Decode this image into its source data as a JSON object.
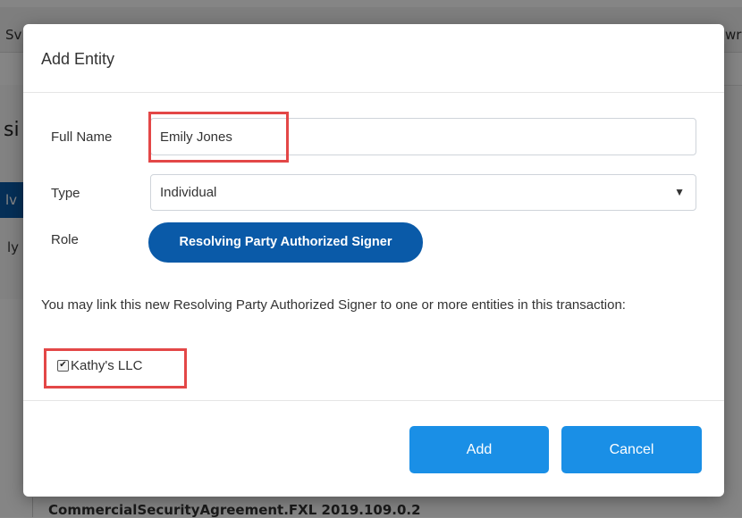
{
  "background": {
    "top_left_text": "Sv",
    "top_right_text": "wr",
    "heading_fragment": "si",
    "tab_fragment": "lv",
    "row_fragment": "ly",
    "bottom_text": "CommercialSecurityAgreement.FXL   2019.109.0.2"
  },
  "modal": {
    "title": "Add Entity",
    "full_name": {
      "label": "Full Name",
      "value": "Emily Jones"
    },
    "type": {
      "label": "Type",
      "selected": "Individual"
    },
    "role": {
      "label": "Role",
      "value": "Resolving Party Authorized Signer"
    },
    "help_text": "You may link this new Resolving Party Authorized Signer to one or more entities in this transaction:",
    "link_option": {
      "label": "Kathy's LLC",
      "checked": true
    },
    "buttons": {
      "add": "Add",
      "cancel": "Cancel"
    }
  },
  "colors": {
    "primary": "#1a8fe6",
    "role_pill": "#0a5aa8",
    "highlight": "#e34747"
  }
}
